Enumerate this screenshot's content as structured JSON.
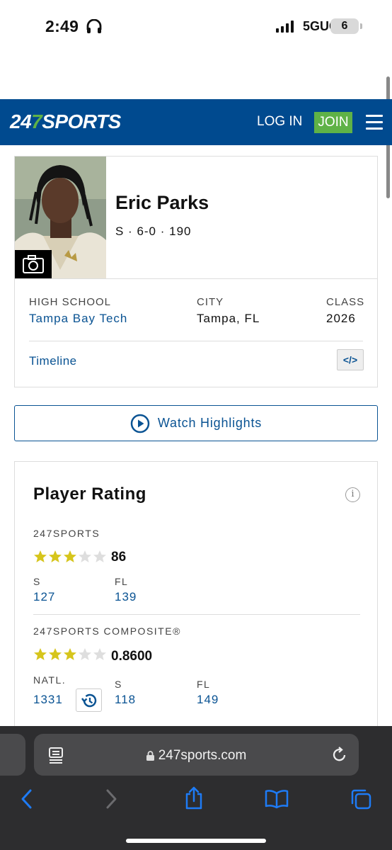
{
  "status_bar": {
    "time": "2:49",
    "network": "5GUC",
    "battery": "6"
  },
  "header": {
    "logo_part1": "24",
    "logo_part2": "7",
    "logo_part3": "SPORTS",
    "login_label": "LOG IN",
    "join_label": "JOIN"
  },
  "player": {
    "name": "Eric Parks",
    "meta": "S · 6-0 · 190",
    "high_school_label": "HIGH SCHOOL",
    "high_school": "Tampa Bay Tech",
    "city_label": "CITY",
    "city": "Tampa, FL",
    "class_label": "CLASS",
    "class": "2026",
    "timeline_label": "Timeline",
    "embed_label": "</>"
  },
  "highlights": {
    "label": "Watch Highlights"
  },
  "rating": {
    "title": "Player Rating",
    "info": "i",
    "sports247": {
      "label": "247SPORTS",
      "stars": 3,
      "max_stars": 5,
      "score": "86",
      "pos_label": "S",
      "pos_rank": "127",
      "state_label": "FL",
      "state_rank": "139"
    },
    "composite": {
      "label": "247SPORTS COMPOSITE®",
      "stars": 3,
      "max_stars": 5,
      "score": "0.8600",
      "natl_label": "NATL.",
      "natl_rank": "1331",
      "pos_label": "S",
      "pos_rank": "118",
      "state_label": "FL",
      "state_rank": "149"
    }
  },
  "browser": {
    "url": "247sports.com"
  },
  "colors": {
    "brand_blue": "#004a8f",
    "join_green": "#5fb247",
    "link_blue": "#0a5393",
    "star_gold": "#d6c51c",
    "star_empty": "#dedede"
  }
}
